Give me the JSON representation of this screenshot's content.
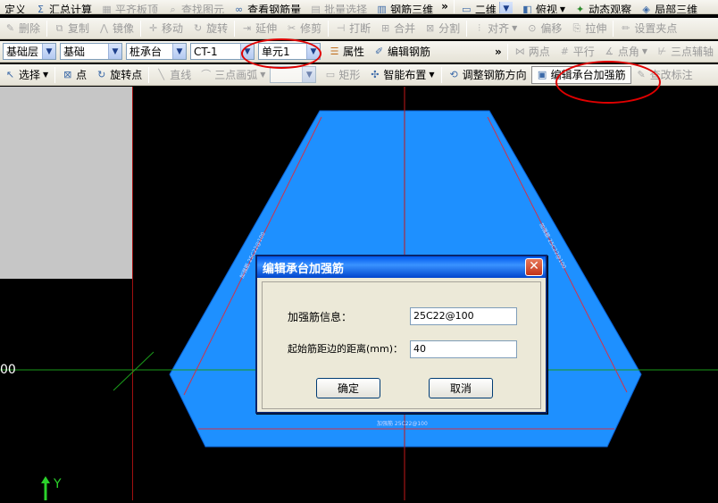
{
  "toolbar1": {
    "define": "定义",
    "sum": "汇总计算",
    "flat_slab": "平齐板顶",
    "find": "查找图元",
    "view_rebar_qty": "查看钢筋量",
    "batch_select": "批量选择",
    "rebar_3d": "钢筋三维",
    "view_mode": "二维",
    "view_dir": "俯视",
    "dynamic_view": "动态观察",
    "local_3d": "局部三维"
  },
  "toolbar2": {
    "delete": "删除",
    "copy": "复制",
    "mirror": "镜像",
    "move": "移动",
    "rotate": "旋转",
    "extend": "延伸",
    "trim": "修剪",
    "break": "打断",
    "merge": "合并",
    "split": "分割",
    "align": "对齐",
    "offset": "偏移",
    "stretch": "拉伸",
    "set_point": "设置夹点"
  },
  "toolbar3": {
    "layer": "基础层",
    "category": "基础",
    "element_type": "桩承台",
    "element_name": "CT-1",
    "unit": "单元1",
    "properties": "属性",
    "edit_rebar": "编辑钢筋",
    "two_points": "两点",
    "parallel": "平行",
    "point_angle": "点角",
    "three_point_aux": "三点辅轴"
  },
  "toolbar4": {
    "select": "选择",
    "point": "点",
    "rotate_point": "旋转点",
    "line": "直线",
    "three_point_arc": "三点画弧",
    "rect": "矩形",
    "smart_layout": "智能布置",
    "adjust_rebar_dir": "调整钢筋方向",
    "edit_cap_reinforce": "编辑承台加强筋",
    "check_annotation": "查改标注"
  },
  "canvas": {
    "rebar_label_left": "加强筋 25C22@100",
    "rebar_label_right": "加强筋 25C22@100",
    "rebar_label_bottom": "加强筋 25C22@100",
    "coord_text": "00",
    "axis_y": "Y",
    "colors": {
      "cap_fill": "#1e90ff",
      "rebar_line": "#d0324a",
      "grid_line": "#1a9a1a",
      "background": "#000000"
    }
  },
  "dialog": {
    "title": "编辑承台加强筋",
    "info_label": "加强筋信息：",
    "info_value": "25C22@100",
    "distance_label": "起始筋距边的距离(mm)：",
    "distance_value": "40",
    "ok": "确定",
    "cancel": "取消"
  }
}
